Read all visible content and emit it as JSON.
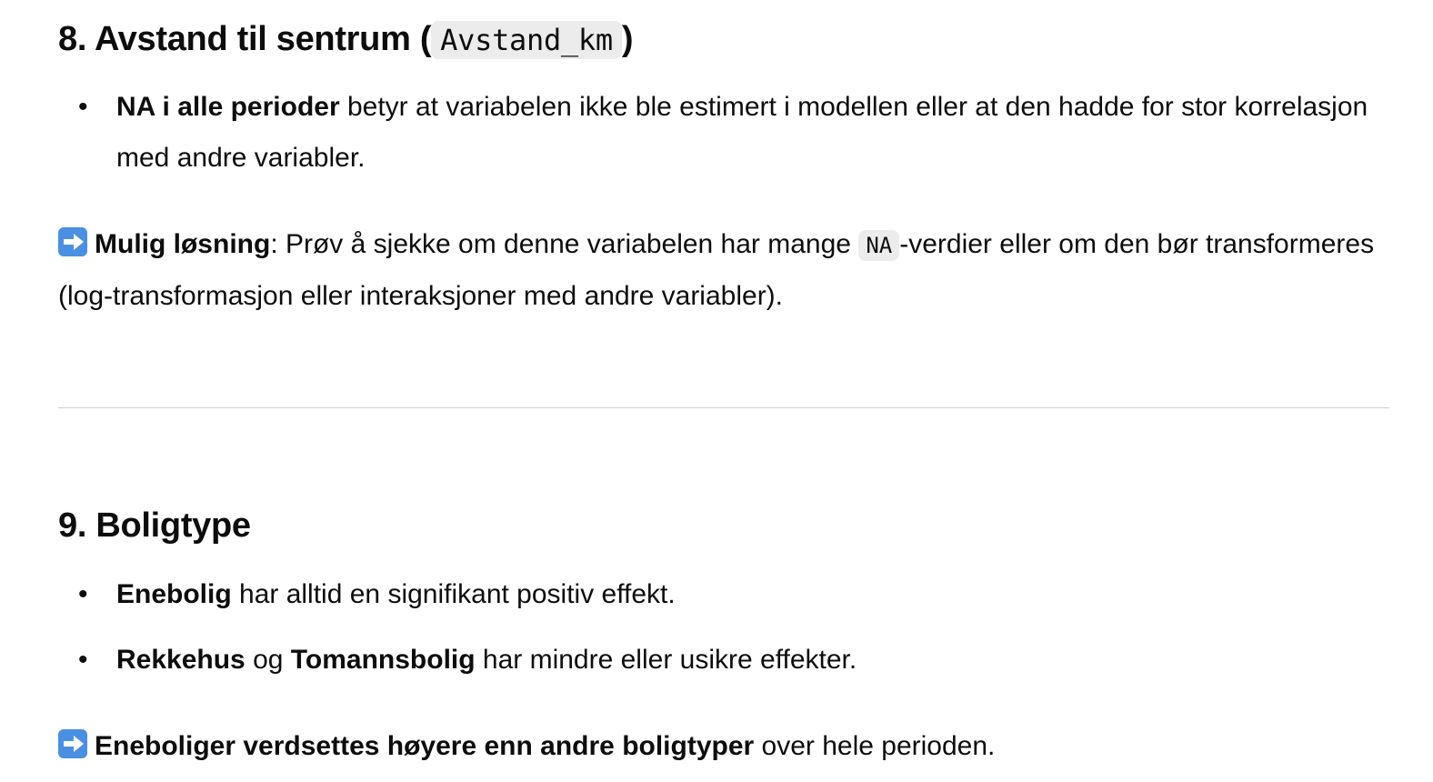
{
  "section8": {
    "heading_prefix": "8. Avstand til sentrum (",
    "heading_code": "Avstand_km",
    "heading_suffix": ")",
    "bullets": [
      {
        "bold": "NA i alle perioder",
        "text": " betyr at variabelen ikke ble estimert i modellen eller at den hadde for stor korrelasjon med andre variabler."
      }
    ],
    "solution": {
      "icon": "right-arrow-icon",
      "bold": "Mulig løsning",
      "text_before_code": ": Prøv å sjekke om denne variabelen har mange ",
      "code": "NA",
      "text_after_code": "-verdier eller om den bør transformeres (log-transformasjon eller interaksjoner med andre variabler)."
    }
  },
  "section9": {
    "heading": "9. Boligtype",
    "bullets": [
      {
        "bold": "Enebolig",
        "text": " har alltid en signifikant positiv effekt."
      },
      {
        "bold": "Rekkehus",
        "mid": " og ",
        "bold2": "Tomannsbolig",
        "text": " har mindre eller usikre effekter."
      }
    ],
    "conclusion": {
      "icon": "right-arrow-icon",
      "bold": "Eneboliger verdsettes høyere enn andre boligtyper",
      "text": " over hele perioden."
    }
  }
}
